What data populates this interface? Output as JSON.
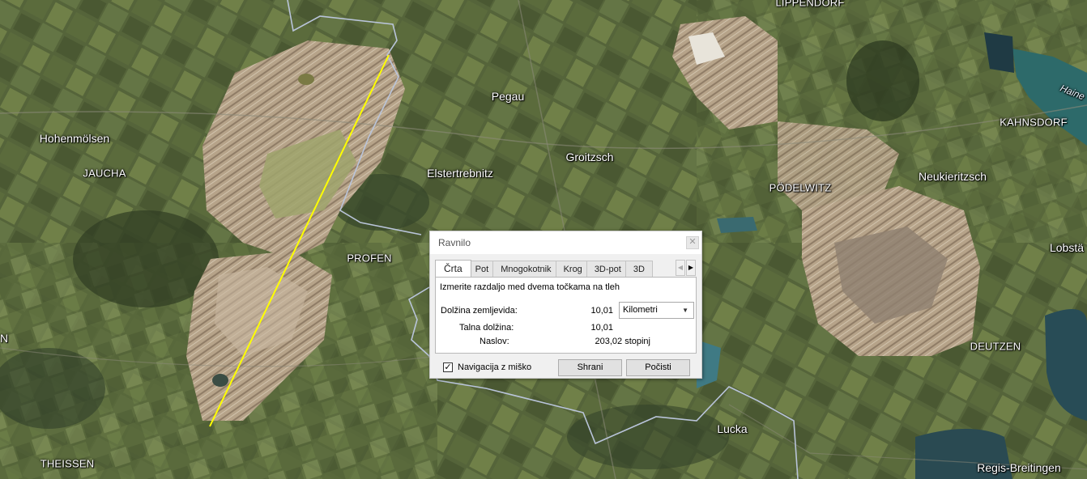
{
  "map": {
    "places": [
      {
        "id": "lippendorf",
        "label": "LIPPENDORF"
      },
      {
        "id": "pegau",
        "label": "Pegau"
      },
      {
        "id": "hohenmolsen",
        "label": "Hohenmölsen"
      },
      {
        "id": "jaucha",
        "label": "JAUCHA"
      },
      {
        "id": "groitzsch",
        "label": "Groitzsch"
      },
      {
        "id": "elstertrebnitz",
        "label": "Elstertrebnitz"
      },
      {
        "id": "kahnsdorf",
        "label": "KAHNSDORF"
      },
      {
        "id": "podelwitz",
        "label": "PÖDELWITZ"
      },
      {
        "id": "neukieritzsch",
        "label": "Neukieritzsch"
      },
      {
        "id": "profen",
        "label": "PROFEN"
      },
      {
        "id": "lobsta",
        "label": "Lobstä"
      },
      {
        "id": "deutzen",
        "label": "DEUTZEN"
      },
      {
        "id": "lucka",
        "label": "Lucka"
      },
      {
        "id": "theissen",
        "label": "THEISSEN"
      },
      {
        "id": "regis",
        "label": "Regis-Breitingen"
      },
      {
        "id": "haine",
        "label": "Haine"
      },
      {
        "id": "edge-n",
        "label": "N"
      }
    ],
    "colors": {
      "measure_line": "#ffff00",
      "border_line": "#b9c4da",
      "mine": "#b8a48c"
    }
  },
  "ruler": {
    "title": "Ravnilo",
    "close_icon": "close-icon",
    "tabs": [
      {
        "label": "Črta",
        "active": true
      },
      {
        "label": "Pot"
      },
      {
        "label": "Mnogokotnik"
      },
      {
        "label": "Krog"
      },
      {
        "label": "3D-pot"
      },
      {
        "label": "3D"
      }
    ],
    "description": "Izmerite razdaljo med dvema točkama na tleh",
    "map_length_label": "Dolžina zemljevida:",
    "map_length_value": "10,01",
    "unit_selected": "Kilometri",
    "ground_length_label": "Talna dolžina:",
    "ground_length_value": "10,01",
    "heading_label": "Naslov:",
    "heading_value": "203,02 stopinj",
    "mouse_nav_label": "Navigacija z miško",
    "mouse_nav_checked": true,
    "save_label": "Shrani",
    "clear_label": "Počisti"
  }
}
